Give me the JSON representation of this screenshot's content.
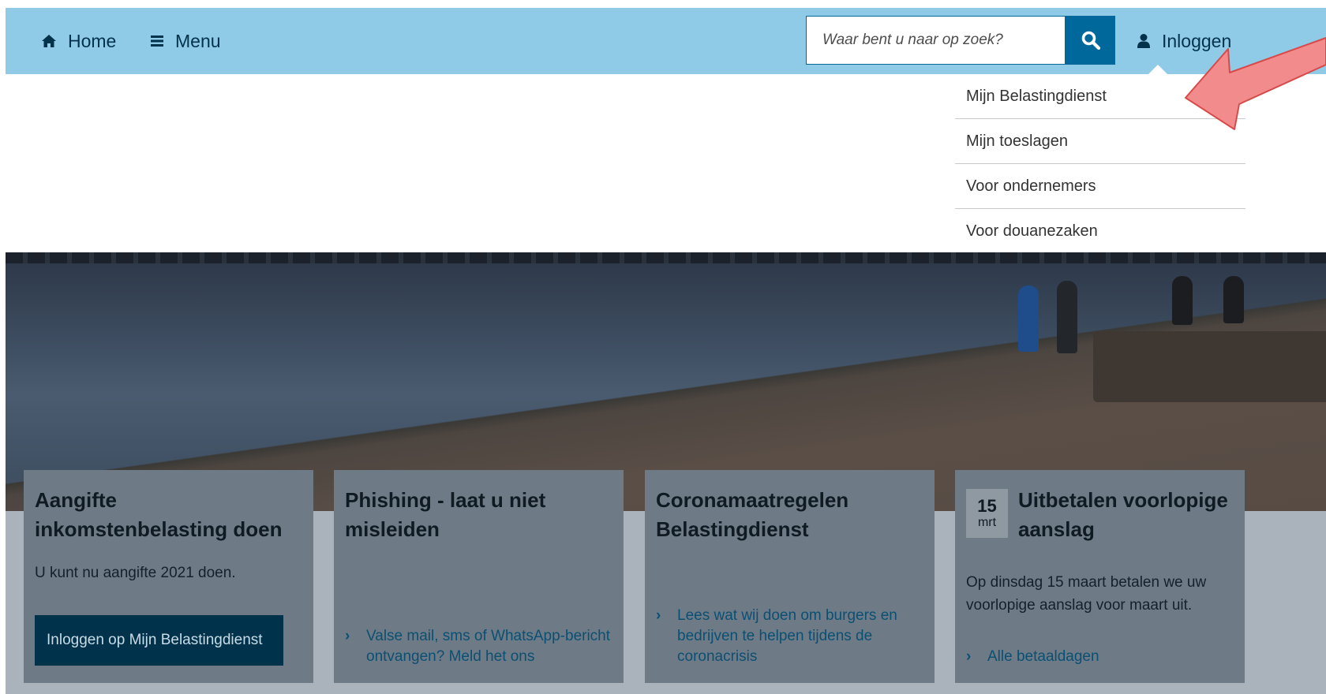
{
  "nav": {
    "home_label": "Home",
    "menu_label": "Menu",
    "search_placeholder": "Waar bent u naar op zoek?",
    "login_label": "Inloggen"
  },
  "dropdown": {
    "items": [
      {
        "label": "Mijn Belastingdienst"
      },
      {
        "label": "Mijn toeslagen"
      },
      {
        "label": "Voor ondernemers"
      },
      {
        "label": "Voor douanezaken"
      }
    ]
  },
  "cards": [
    {
      "title": "Aangifte inkomstenbelasting doen",
      "text": "U kunt nu aangifte 2021 doen.",
      "button_label": "Inloggen op Mijn Belastingdienst"
    },
    {
      "title": "Phishing - laat u niet misleiden",
      "link": "Valse mail, sms of WhatsApp-bericht ontvangen? Meld het ons"
    },
    {
      "title": "Coronamaatregelen Belastingdienst",
      "link": "Lees wat wij doen om burgers en bedrijven te helpen tijdens de coronacrisis"
    },
    {
      "date_day": "15",
      "date_month": "mrt",
      "title": "Uitbetalen voorlopige aanslag",
      "text": "Op dinsdag 15 maart betalen we uw voorlopige aanslag voor maart uit.",
      "link": "Alle betaaldagen"
    }
  ],
  "colors": {
    "navbar": "#8fcae7",
    "primary": "#01689b",
    "dark_button": "#01324c",
    "card": "#6e7b86",
    "annotation_arrow": "#f28b8b"
  },
  "icons": [
    "home-icon",
    "menu-icon",
    "search-icon",
    "user-icon",
    "chevron-right-icon",
    "annotation-arrow"
  ]
}
